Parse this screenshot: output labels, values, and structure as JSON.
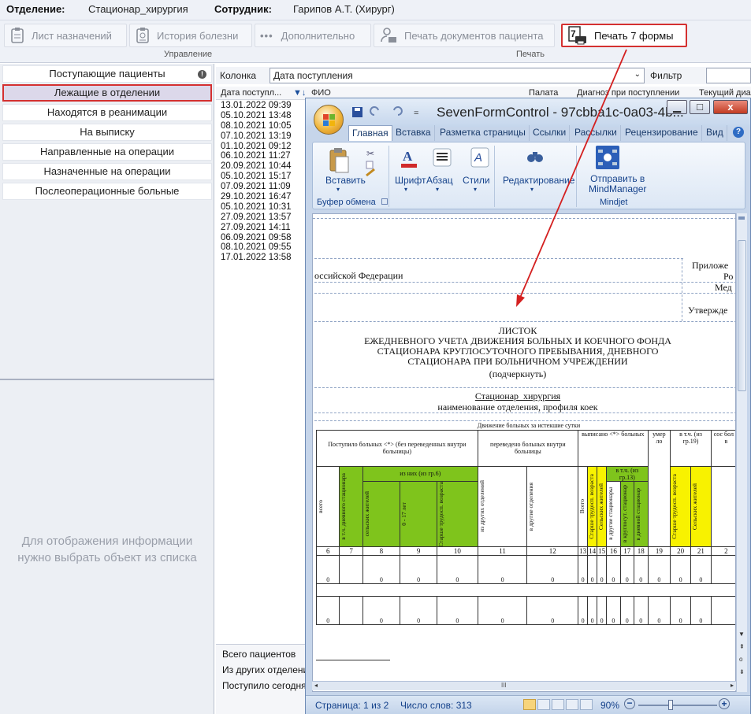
{
  "topbar": {
    "dept_label": "Отделение:",
    "dept_value": "Стационар_хирургия",
    "emp_label": "Сотрудник:",
    "emp_value": "Гарипов А.Т. (Хирург)"
  },
  "toolbar": {
    "btn_prescriptions": "Лист назначений",
    "btn_history": "История болезни",
    "btn_more": "Дополнительно",
    "btn_print_docs": "Печать документов пациента",
    "btn_print7": "Печать 7 формы",
    "group_manage": "Управление",
    "group_print": "Печать"
  },
  "sidebar": {
    "items": [
      "Поступающие пациенты",
      "Лежащие в отделении",
      "Находятся в реанимации",
      "На выписку",
      "Направленные на операции",
      "Назначенные на операции",
      "Послеоперационные больные"
    ],
    "empty_msg_1": "Для отображения информации",
    "empty_msg_2": "нужно выбрать объект из списка"
  },
  "filter": {
    "column_label": "Колонка",
    "column_value": "Дата поступления",
    "filter_label": "Фильтр"
  },
  "grid": {
    "headers": {
      "date": "Дата поступл...",
      "fio": "ФИО",
      "ward": "Палата",
      "diagnosis": "Диагноз при поступлении",
      "current": "Текущий диа"
    },
    "dates": [
      "13.01.2022 09:39",
      "05.10.2021 13:48",
      "08.10.2021 10:05",
      "07.10.2021 13:19",
      "01.10.2021 09:12",
      "06.10.2021 11:27",
      "20.09.2021 10:44",
      "05.10.2021 15:17",
      "07.09.2021 11:09",
      "29.10.2021 16:47",
      "05.10.2021 10:31",
      "27.09.2021 13:57",
      "27.09.2021 14:11",
      "06.09.2021 09:58",
      "08.10.2021 09:55",
      "17.01.2022 13:58"
    ]
  },
  "summary": {
    "total": "Всего пациентов",
    "from_other": "Из других отделени",
    "admitted_today": "Поступило сегодня"
  },
  "word": {
    "title": "SevenFormControl - 97cbba1c-0a03-4b...",
    "tabs": [
      "Главная",
      "Вставка",
      "Разметка страницы",
      "Ссылки",
      "Рассылки",
      "Рецензирование",
      "Вид"
    ],
    "paste": "Вставить",
    "font": "Шрифт",
    "paragraph": "Абзац",
    "styles": "Стили",
    "editing": "Редактирование",
    "send_to": "Отправить в",
    "mindmanager": "MindManager",
    "clipboard": "Буфер обмена",
    "mindjet": "Mindjet",
    "status_page": "Страница: 1 из 2",
    "status_words": "Число слов: 313",
    "zoom": "90%"
  },
  "doc": {
    "appendix": "Приложе",
    "ro": "Ро",
    "med": "Мед",
    "approved": "Утвержде",
    "federation": "оссийской Федерации",
    "title1": "ЛИСТОК",
    "title2": "ЕЖЕДНЕВНОГО УЧЕТА ДВИЖЕНИЯ БОЛЬНЫХ И КОЕЧНОГО ФОНДА",
    "title3": "СТАЦИОНАРА КРУГЛОСУТОЧНОГО ПРЕБЫВАНИЯ, ДНЕВНОГО",
    "title4": "СТАЦИОНАРА ПРИ БОЛЬНИЧНОМ УЧРЕЖДЕНИИ",
    "title5": "(подчеркнуть)",
    "dept": "Стационар_хирургия",
    "dept_caption": "наименование отделения, профиля коек",
    "movement": "Движение больных за истекшие сутки",
    "h_admitted": "Поступило больных <*> (без переведенных внутри больницы)",
    "h_transferred": "переведено больных внутри больницы",
    "h_discharged": "выписано <*>  больных",
    "h_died": "умер ло",
    "h_incl19": "в т.ч. (из гр.19)",
    "h_cut": "сос бол х в",
    "h_of_them": "из них (из гр.6)",
    "h_incl13": "в т.ч. (из гр.13)",
    "c_all": "всего",
    "c_day": "в т.ч. дневного стационара",
    "c_rural": "сельских жителей",
    "c_0_17": "0 - 17 лет",
    "c_older": "Старше трудосп. возраста",
    "c_from_other": "из других отделений",
    "c_to_other": "в другие отделения",
    "c_total": "Всего",
    "c_older2": "Старше трудосп. возраста",
    "c_rural2": "Сельских жителей",
    "c_other_hosp": "в другие стационары",
    "c_round": "в круглосут. стационар",
    "c_daystat": "в дневной стационар",
    "c_older3": "Старше трудосп. возраста",
    "c_rural3": "Сельских жителей",
    "nums": [
      "6",
      "7",
      "8",
      "9",
      "10",
      "11",
      "12",
      "13",
      "14",
      "15",
      "16",
      "17",
      "18",
      "19",
      "20",
      "21",
      "2"
    ],
    "zero": "0"
  }
}
